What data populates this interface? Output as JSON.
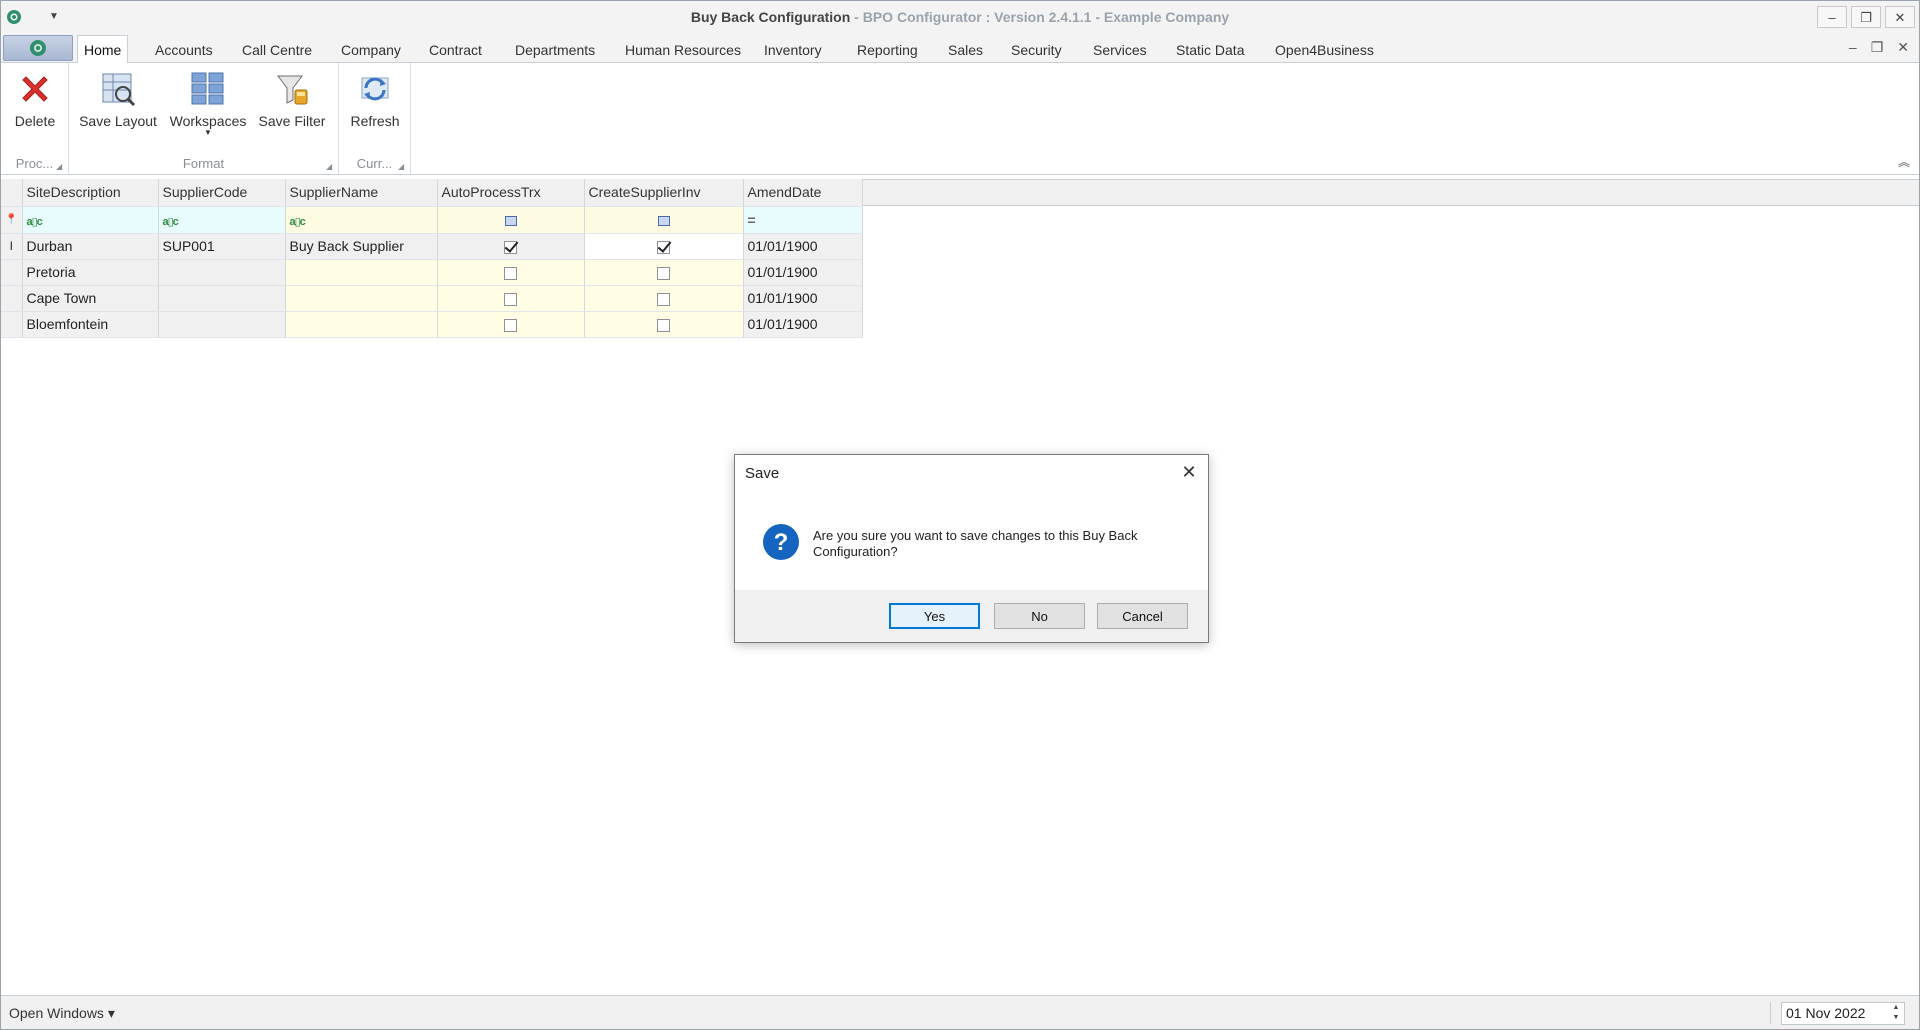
{
  "window": {
    "title_main": "Buy Back Configuration",
    "title_sub": " - BPO Configurator : Version 2.4.1.1 - Example Company",
    "minimize": "–",
    "restore": "❐",
    "close": "✕"
  },
  "tabs": [
    "Home",
    "Accounts",
    "Call Centre",
    "Company",
    "Contract",
    "Departments",
    "Human Resources",
    "Inventory",
    "Reporting",
    "Sales",
    "Security",
    "Services",
    "Static Data",
    "Open4Business"
  ],
  "ribbon": {
    "delete_label": "Delete",
    "save_layout_label": "Save Layout",
    "workspaces_label": "Workspaces",
    "save_filter_label": "Save Filter",
    "refresh_label": "Refresh",
    "group_process": "Proc...",
    "group_format": "Format",
    "group_current": "Curr..."
  },
  "grid": {
    "columns": [
      "SiteDescription",
      "SupplierCode",
      "SupplierName",
      "AutoProcessTrx",
      "CreateSupplierInv",
      "AmendDate"
    ],
    "filter_text_icon": "a▯c",
    "filter_eq_icon": "=",
    "rows": [
      {
        "site": "Durban",
        "code": "SUP001",
        "name": "Buy Back Supplier",
        "auto": true,
        "create": true,
        "date": "01/01/1900"
      },
      {
        "site": "Pretoria",
        "code": "",
        "name": "",
        "auto": false,
        "create": false,
        "date": "01/01/1900"
      },
      {
        "site": "Cape Town",
        "code": "",
        "name": "",
        "auto": false,
        "create": false,
        "date": "01/01/1900"
      },
      {
        "site": "Bloemfontein",
        "code": "",
        "name": "",
        "auto": false,
        "create": false,
        "date": "01/01/1900"
      }
    ]
  },
  "dialog": {
    "title": "Save",
    "message": "Are you sure you want to save changes to this Buy Back Configuration?",
    "yes": "Yes",
    "no": "No",
    "cancel": "Cancel",
    "close": "✕"
  },
  "status": {
    "open_windows": "Open Windows ▾",
    "date": "01 Nov 2022"
  },
  "colors": {
    "accent": "#0078d7",
    "delete_red": "#d9302c",
    "question_blue": "#1565c0"
  }
}
